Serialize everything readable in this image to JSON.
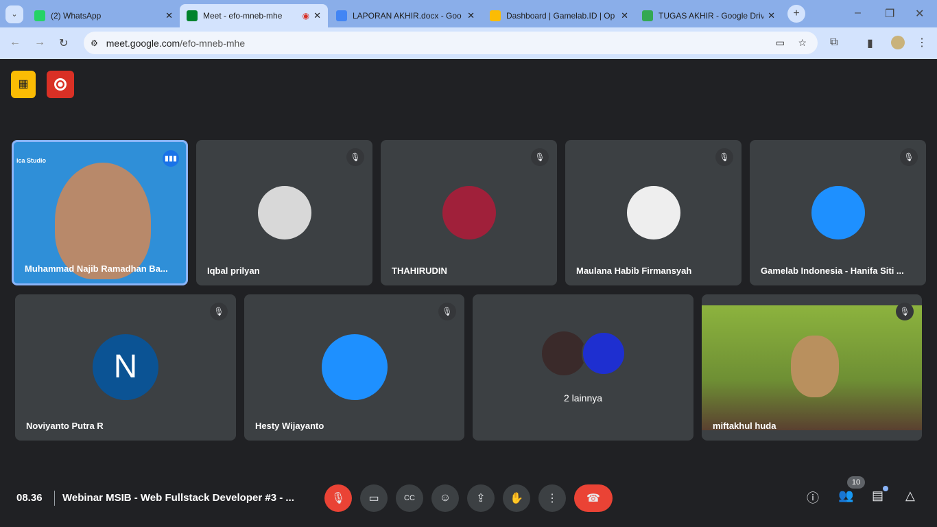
{
  "browser": {
    "tabs": [
      {
        "title": "(2) WhatsApp",
        "icon": "whatsapp-icon",
        "color": "#25d366"
      },
      {
        "title": "Meet - efo-mneb-mhe",
        "icon": "meet-icon",
        "color": "#00832d",
        "active": true
      },
      {
        "title": "LAPORAN AKHIR.docx - Goo",
        "icon": "docs-icon",
        "color": "#4285f4"
      },
      {
        "title": "Dashboard | Gamelab.ID | Op",
        "icon": "gamelab-icon",
        "color": "#fbbc04"
      },
      {
        "title": "TUGAS AKHIR - Google Drive",
        "icon": "drive-icon",
        "color": "#34a853"
      }
    ],
    "url_host": "meet.google.com",
    "url_path": "/efo-mneb-mhe"
  },
  "participants_row1": [
    {
      "name": "Muhammad Najib Ramadhan Ba...",
      "speaking": true,
      "bg": "#2f8fd8"
    },
    {
      "name": "Iqbal prilyan",
      "bg": "#d8d8d8"
    },
    {
      "name": "THAHIRUDIN",
      "bg": "#a0203a"
    },
    {
      "name": "Maulana Habib Firmansyah",
      "bg": "#eeeeee"
    },
    {
      "name": "Gamelab Indonesia - Hanifa Siti ...",
      "bg": "#1e90ff"
    }
  ],
  "participants_row2": [
    {
      "name": "Noviyanto Putra R",
      "initial": "N",
      "bg": "#0b5394"
    },
    {
      "name": "Hesty Wijayanto",
      "bg": "#1e90ff"
    },
    {
      "name": "",
      "others": "2 lainnya",
      "bg": "#3c4043"
    },
    {
      "name": "miftakhul huda",
      "bg": "#7a9a3a"
    }
  ],
  "presenter_overlay": "ica Studio",
  "bottom": {
    "time": "08.36",
    "meeting_title": "Webinar MSIB - Web Fullstack Developer #3 - ...",
    "participant_count": "10"
  },
  "colors": {
    "end_call": "#ea4335",
    "recording": "#d93025",
    "warning": "#fbbc04"
  }
}
